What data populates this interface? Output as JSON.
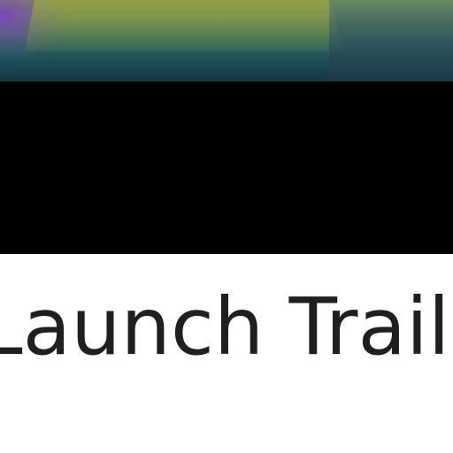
{
  "video": {
    "title": "Launch Trailer"
  }
}
